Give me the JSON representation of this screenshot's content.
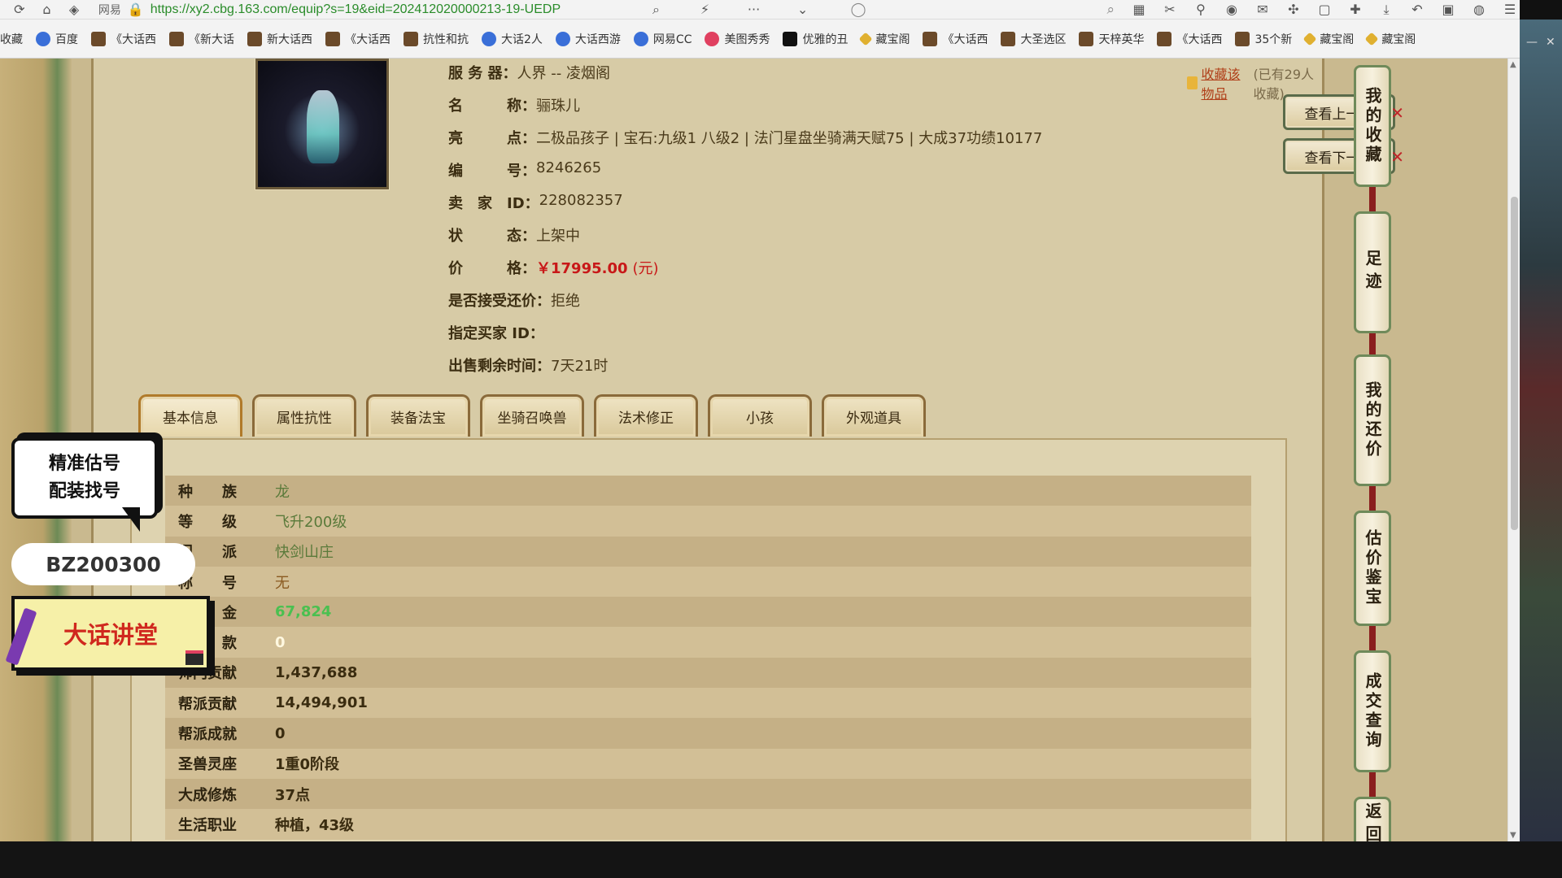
{
  "browser": {
    "site_label": "网易",
    "url": "https://xy2.cbg.163.com/equip?s=19&eid=202412020000213-19-UEDP",
    "more_label": "···",
    "bookmarks": [
      {
        "label": "收藏",
        "icon": "folder-icon"
      },
      {
        "label": "百度",
        "icon": "baidu-icon"
      },
      {
        "label": "《大话西",
        "icon": "game-icon"
      },
      {
        "label": "《新大话",
        "icon": "game-icon"
      },
      {
        "label": "新大话西",
        "icon": "game-icon"
      },
      {
        "label": "《大话西",
        "icon": "game-icon"
      },
      {
        "label": "抗性和抗",
        "icon": "game-icon"
      },
      {
        "label": "大话2人",
        "icon": "wing-icon"
      },
      {
        "label": "大话西游",
        "icon": "wing-icon"
      },
      {
        "label": "网易CC",
        "icon": "cc-icon"
      },
      {
        "label": "美图秀秀",
        "icon": "meitu-icon"
      },
      {
        "label": "优雅的丑",
        "icon": "tiktok-icon"
      },
      {
        "label": "藏宝阁",
        "icon": "cbg-icon"
      },
      {
        "label": "《大话西",
        "icon": "game-icon"
      },
      {
        "label": "大圣选区",
        "icon": "game-icon"
      },
      {
        "label": "天梓英华",
        "icon": "game-icon"
      },
      {
        "label": "《大话西",
        "icon": "game-icon"
      },
      {
        "label": "35个新",
        "icon": "game-icon"
      },
      {
        "label": "藏宝阁",
        "icon": "cbg-icon"
      },
      {
        "label": "藏宝阁",
        "icon": "cbg-icon"
      }
    ]
  },
  "item": {
    "server_label": "服 务 器：",
    "server": "人界 -- 凌烟阁",
    "name_label": "名　　　称：",
    "name": "骊珠儿",
    "highlights_label": "亮　　　点：",
    "highlights": "二极品孩子 | 宝石:九级1 八级2 | 法门星盘坐骑满天赋75 | 大成37功绩10177",
    "number_label": "编　　　号：",
    "number": "8246265",
    "seller_label": "卖　家　ID：",
    "seller_id": "228082357",
    "status_label": "状　　　态：",
    "status": "上架中",
    "price_label": "价　　　格：",
    "price": "￥17995.00",
    "price_unit": "(元)",
    "counter_offer_label": "是否接受还价：",
    "counter_offer": "拒绝",
    "buyer_label": "指定买家 ID：",
    "buyer": "",
    "remaining_label": "出售剩余时间：",
    "remaining": "7天21时"
  },
  "favorite": {
    "link": "收藏该物品",
    "count": "(已有29人收藏)"
  },
  "nav": {
    "prev": "查看上一个",
    "next": "查看下一个"
  },
  "tabs": [
    "基本信息",
    "属性抗性",
    "装备法宝",
    "坐骑召唤兽",
    "法术修正",
    "小孩",
    "外观道具"
  ],
  "basic_info": [
    {
      "key": "种　　族",
      "value": "龙",
      "style": "green-dim"
    },
    {
      "key": "等　　级",
      "value": "飞升200级",
      "style": "green-dim"
    },
    {
      "key": "门　　派",
      "value": "快剑山庄",
      "style": "green-dim"
    },
    {
      "key": "称　　号",
      "value": "无",
      "style": "brown"
    },
    {
      "key": "现　　金",
      "value": "67,824",
      "style": "green"
    },
    {
      "key": "存　　款",
      "value": "0",
      "style": "white"
    },
    {
      "key": "师门贡献",
      "value": "1,437,688",
      "style": "dark"
    },
    {
      "key": "帮派贡献",
      "value": "14,494,901",
      "style": "dark"
    },
    {
      "key": "帮派成就",
      "value": "0",
      "style": "dark"
    },
    {
      "key": "圣兽灵座",
      "value": "1重0阶段",
      "style": "dark"
    },
    {
      "key": "大成修炼",
      "value": "37点",
      "style": "dark"
    },
    {
      "key": "生活职业",
      "value": "种植，43级",
      "style": "dark"
    }
  ],
  "side_menu": [
    "我的收藏",
    "足迹",
    "我的还价",
    "估价鉴宝",
    "成交查询",
    "返回"
  ],
  "overlay": {
    "bubble_line1": "精准估号",
    "bubble_line2": "配装找号",
    "code": "BZ200300",
    "class_name": "大话讲堂"
  },
  "colors": {
    "page_bg": "#c9b98f",
    "price": "#c81818",
    "row_odd": "#c5b086",
    "row_even": "#d2bf96"
  }
}
